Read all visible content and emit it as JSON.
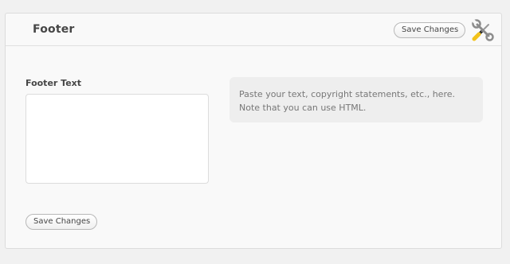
{
  "panel": {
    "title": "Footer",
    "save_top_label": "Save Changes",
    "save_bottom_label": "Save Changes",
    "icon": "tools-icon"
  },
  "field": {
    "label": "Footer Text",
    "value": "",
    "placeholder": ""
  },
  "help": {
    "line1": "Paste your text, copyright statements, etc., here.",
    "line2": "Note that you can use HTML."
  }
}
